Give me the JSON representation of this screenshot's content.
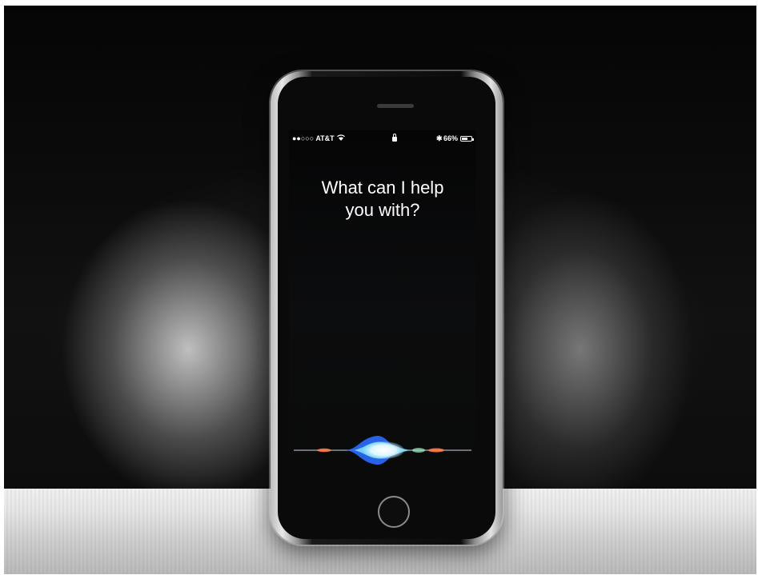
{
  "status_bar": {
    "carrier": "●●○○○ AT&T",
    "wifi_icon": "wifi-icon",
    "lock_icon": "lock-icon",
    "bluetooth": "✱",
    "battery_percent": "66%",
    "battery_level": 0.66
  },
  "siri": {
    "prompt": "What can I help\nyou with?"
  },
  "colors": {
    "wave_blue": "#2a6bff",
    "wave_cyan": "#7fe0ff",
    "wave_white": "#ffffff",
    "wave_orange": "#ff7a4a"
  }
}
